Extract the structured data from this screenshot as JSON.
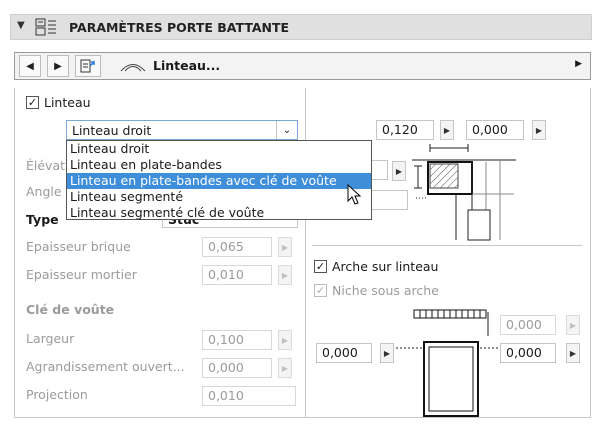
{
  "header": {
    "title": "PARAMÈTRES PORTE BATTANTE"
  },
  "nav": {
    "current": "Linteau..."
  },
  "left": {
    "linteau_label": "Linteau",
    "lintel_select": "Linteau droit",
    "options": [
      "Linteau droit",
      "Linteau en plate-bandes",
      "Linteau en plate-bandes avec clé de voûte",
      "Linteau segmenté",
      "Linteau segmenté clé de voûte"
    ],
    "elev_label": "Élévat",
    "angle_label": "Angle",
    "type_label": "Type",
    "type_value": "Stuc",
    "brick_label": "Epaisseur brique",
    "brick_value": "0,065",
    "mortar_label": "Epaisseur mortier",
    "mortar_value": "0,010",
    "key_title": "Clé de voûte",
    "width_label": "Largeur",
    "width_value": "0,100",
    "enlarge_label": "Agrandissement ouvert...",
    "enlarge_value": "0,000",
    "proj_label": "Projection",
    "proj_value": "0,010"
  },
  "right": {
    "top_left_value": "0,120",
    "top_right_value": "0,000",
    "arch_label": "Arche sur linteau",
    "niche_label": "Niche sous arche",
    "arch_top_value": "0,000",
    "arch_left_value": "0,000",
    "arch_right_value": "0,000"
  }
}
